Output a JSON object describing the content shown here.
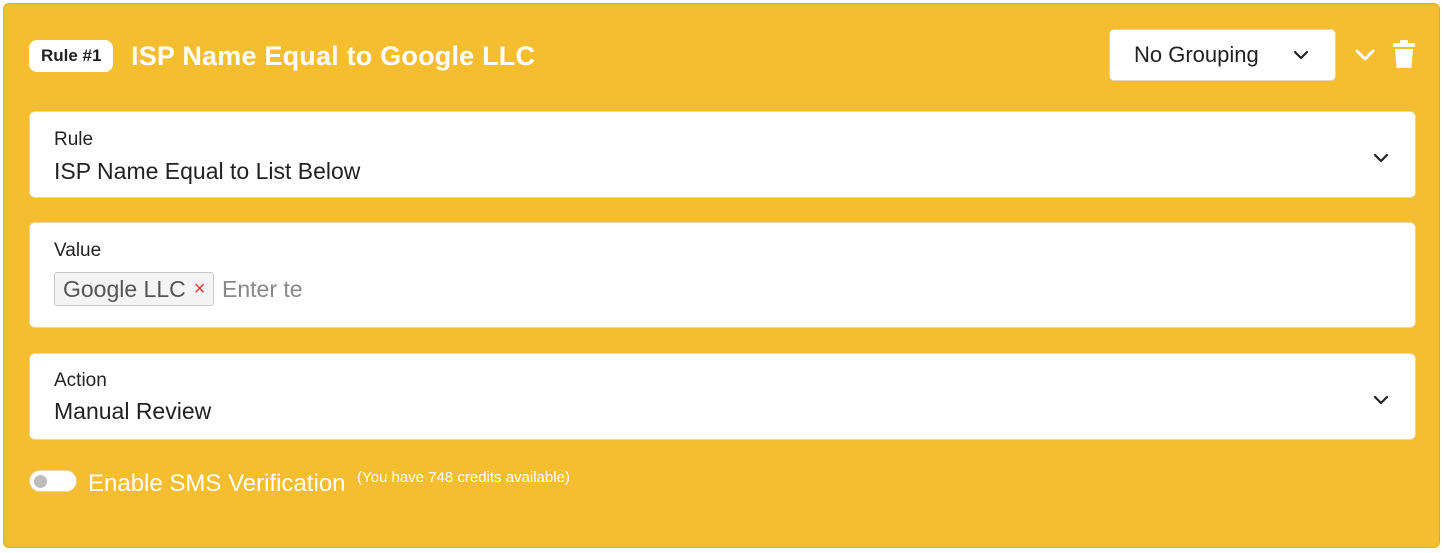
{
  "header": {
    "rule_badge": "Rule #1",
    "title": "ISP Name Equal to Google LLC",
    "grouping_value": "No Grouping"
  },
  "rule_field": {
    "label": "Rule",
    "value": "ISP Name Equal to List Below"
  },
  "value_field": {
    "label": "Value",
    "tags": [
      "Google LLC"
    ],
    "tag_remove": "×",
    "placeholder": "Enter te"
  },
  "action_field": {
    "label": "Action",
    "value": "Manual Review"
  },
  "sms": {
    "label": "Enable SMS Verification",
    "note": "(You have 748 credits available)",
    "enabled": false
  },
  "icons": {
    "grouping": "chevron-down-icon",
    "collapse": "chevron-down-icon",
    "delete": "trash-icon",
    "dropdown": "chevron-down-icon"
  },
  "colors": {
    "card_background": "#f4be30",
    "tag_remove": "#e03a3a"
  }
}
